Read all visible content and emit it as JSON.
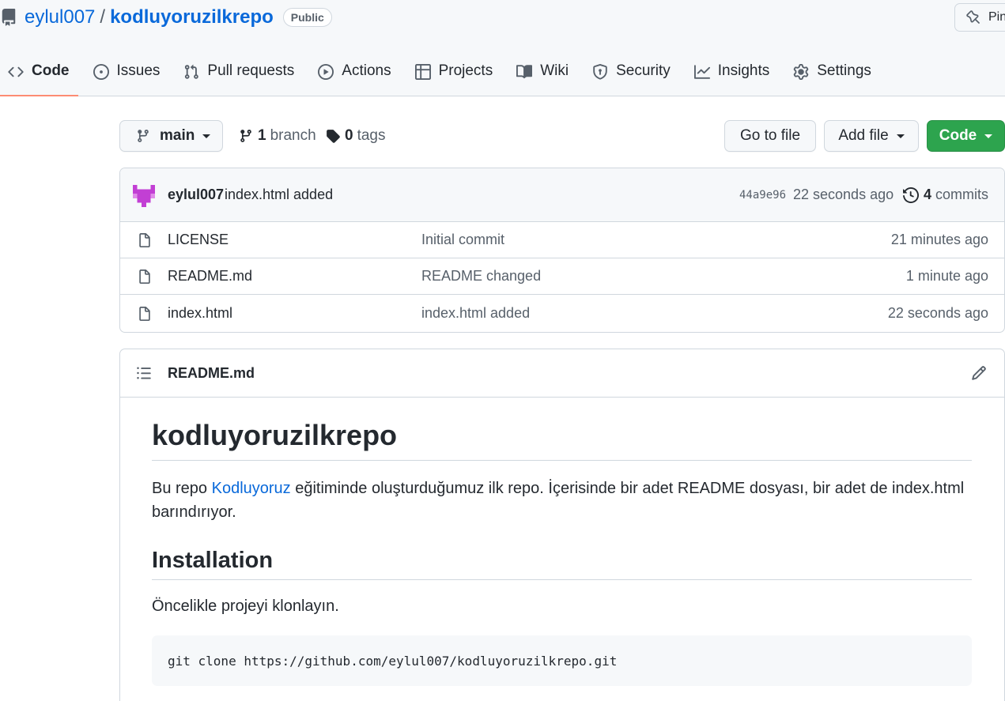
{
  "repo": {
    "owner": "eylul007",
    "separator": "/",
    "name": "kodluyoruzilkrepo",
    "visibility": "Public",
    "pin_label": "Pin"
  },
  "tabs": [
    {
      "label": "Code",
      "icon": "code-icon",
      "selected": true
    },
    {
      "label": "Issues",
      "icon": "issue-icon"
    },
    {
      "label": "Pull requests",
      "icon": "pull-request-icon"
    },
    {
      "label": "Actions",
      "icon": "play-icon"
    },
    {
      "label": "Projects",
      "icon": "table-icon"
    },
    {
      "label": "Wiki",
      "icon": "book-icon"
    },
    {
      "label": "Security",
      "icon": "shield-icon"
    },
    {
      "label": "Insights",
      "icon": "graph-icon"
    },
    {
      "label": "Settings",
      "icon": "gear-icon"
    }
  ],
  "toolbar": {
    "branch": "main",
    "branch_count": "1",
    "branch_label": "branch",
    "tag_count": "0",
    "tag_label": "tags",
    "goto_file": "Go to file",
    "add_file": "Add file",
    "code": "Code"
  },
  "latest_commit": {
    "author": "eylul007",
    "message": "index.html added",
    "sha": "44a9e96",
    "time": "22 seconds ago",
    "commit_count": "4",
    "commit_label": "commits"
  },
  "files": [
    {
      "name": "LICENSE",
      "message": "Initial commit",
      "age": "21 minutes ago"
    },
    {
      "name": "README.md",
      "message": "README changed",
      "age": "1 minute ago"
    },
    {
      "name": "index.html",
      "message": "index.html added",
      "age": "22 seconds ago"
    }
  ],
  "readme": {
    "filename": "README.md",
    "h1": "kodluyoruzilkrepo",
    "intro_before": "Bu repo ",
    "intro_link": "Kodluyoruz",
    "intro_after": " eğitiminde oluşturduğumuz ilk repo. İçerisinde bir adet README dosyası, bir adet de index.html barındırıyor.",
    "h2": "Installation",
    "install_text": "Öncelikle projeyi klonlayın.",
    "code": "git clone https://github.com/eylul007/kodluyoruzilkrepo.git"
  },
  "colors": {
    "accent_link": "#0969da",
    "primary_button": "#2da44e",
    "tab_underline": "#fd8c73",
    "avatar": "#c23fd4"
  }
}
